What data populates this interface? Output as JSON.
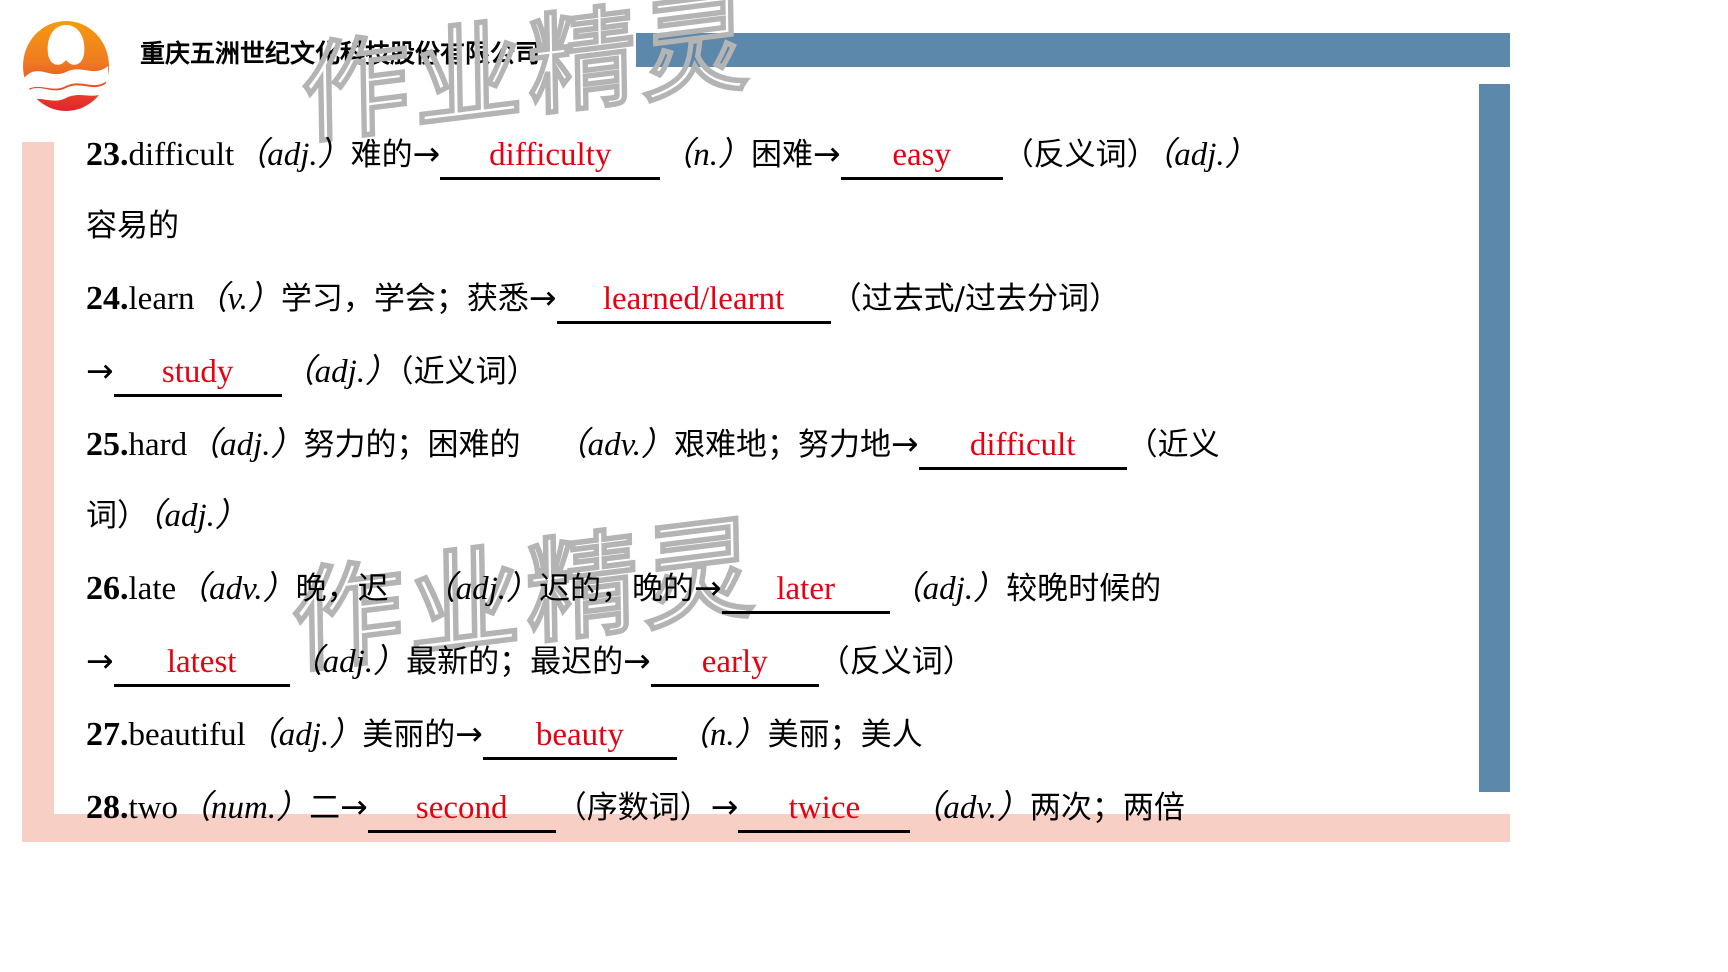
{
  "header": {
    "company_name": "重庆五洲世纪文化科技股份有限公司",
    "logo_name": "wuzhou-logo"
  },
  "watermark": {
    "text": "作业精灵"
  },
  "colors": {
    "answer_red": "#e60012",
    "bar_blue": "#5b88ab",
    "bar_pink": "#f7cfc5",
    "logo_orange": "#f18a1c",
    "logo_red": "#e03a3e"
  },
  "entries": [
    {
      "number": "23.",
      "word": "difficult",
      "parts": [
        {
          "type": "pos",
          "text": "（adj.）"
        },
        {
          "type": "cn",
          "text": "难的"
        },
        {
          "type": "arrow",
          "text": "→"
        },
        {
          "type": "answer",
          "text": "difficulty"
        },
        {
          "type": "pos",
          "text": "（n.）"
        },
        {
          "type": "cn",
          "text": "困难"
        },
        {
          "type": "arrow",
          "text": "→"
        },
        {
          "type": "answer",
          "text": "easy"
        },
        {
          "type": "cn",
          "text": "（反义词）"
        },
        {
          "type": "pos",
          "text": "（adj.）"
        },
        {
          "type": "cn-wrap",
          "text": "容易的"
        }
      ]
    },
    {
      "number": "24.",
      "word": "learn",
      "parts": [
        {
          "type": "pos",
          "text": "（v.）"
        },
        {
          "type": "cn",
          "text": "学习，学会；获悉"
        },
        {
          "type": "arrow",
          "text": "→"
        },
        {
          "type": "answer",
          "text": "learned/learnt"
        },
        {
          "type": "cn",
          "text": "（过去式/过去分词）"
        },
        {
          "type": "arrow-wrap",
          "text": "→"
        },
        {
          "type": "answer",
          "text": "study"
        },
        {
          "type": "pos",
          "text": "（adj.）"
        },
        {
          "type": "cn",
          "text": "（近义词）"
        }
      ]
    },
    {
      "number": "25.",
      "word": "hard",
      "parts": [
        {
          "type": "pos",
          "text": "（adj.）"
        },
        {
          "type": "cn",
          "text": "努力的；困难的"
        },
        {
          "type": "pos",
          "text": "（adv.）"
        },
        {
          "type": "cn",
          "text": "艰难地；努力地"
        },
        {
          "type": "arrow",
          "text": "→"
        },
        {
          "type": "answer",
          "text": "difficult"
        },
        {
          "type": "cn",
          "text": "（近义词）"
        },
        {
          "type": "pos",
          "text": "（adj.）"
        }
      ]
    },
    {
      "number": "26.",
      "word": "late",
      "parts": [
        {
          "type": "pos",
          "text": "（adv.）"
        },
        {
          "type": "cn",
          "text": "晚，迟"
        },
        {
          "type": "pos",
          "text": "（adj.）"
        },
        {
          "type": "cn",
          "text": "迟的，晚的"
        },
        {
          "type": "arrow",
          "text": "→"
        },
        {
          "type": "answer",
          "text": "later"
        },
        {
          "type": "pos",
          "text": "（adj.）"
        },
        {
          "type": "cn",
          "text": "较晚时候的"
        },
        {
          "type": "arrow-wrap",
          "text": "→"
        },
        {
          "type": "answer",
          "text": "latest"
        },
        {
          "type": "pos",
          "text": "（adj.）"
        },
        {
          "type": "cn",
          "text": "最新的；最迟的"
        },
        {
          "type": "arrow",
          "text": "→"
        },
        {
          "type": "answer",
          "text": "early"
        },
        {
          "type": "cn",
          "text": "（反义词）"
        }
      ]
    },
    {
      "number": "27.",
      "word": "beautiful",
      "parts": [
        {
          "type": "pos",
          "text": "（adj.）"
        },
        {
          "type": "cn",
          "text": "美丽的"
        },
        {
          "type": "arrow",
          "text": "→"
        },
        {
          "type": "answer",
          "text": "beauty"
        },
        {
          "type": "pos",
          "text": "（n.）"
        },
        {
          "type": "cn",
          "text": "美丽；美人"
        }
      ]
    },
    {
      "number": "28.",
      "word": "two",
      "parts": [
        {
          "type": "pos",
          "text": "（num.）"
        },
        {
          "type": "cn",
          "text": "二"
        },
        {
          "type": "arrow",
          "text": "→"
        },
        {
          "type": "answer",
          "text": "second"
        },
        {
          "type": "cn",
          "text": "（序数词）"
        },
        {
          "type": "arrow",
          "text": "→"
        },
        {
          "type": "answer",
          "text": "twice"
        },
        {
          "type": "pos",
          "text": "（adv.）"
        },
        {
          "type": "cn",
          "text": "两次；两倍"
        }
      ]
    }
  ],
  "lines": [
    {
      "id": "line-23a",
      "tokens": [
        {
          "k": "num",
          "t": "23."
        },
        {
          "k": "en",
          "t": "difficult"
        },
        {
          "k": "pos",
          "t": "（adj.）"
        },
        {
          "k": "cn",
          "t": "难的"
        },
        {
          "k": "arrow",
          "t": "→"
        },
        {
          "k": "ans",
          "t": "difficulty",
          "w": "184"
        },
        {
          "k": "pos",
          "t": "（n.）"
        },
        {
          "k": "cn",
          "t": "困难"
        },
        {
          "k": "arrow",
          "t": "→"
        },
        {
          "k": "ans",
          "t": "easy",
          "w": "126"
        },
        {
          "k": "cn",
          "t": "（反义词）"
        },
        {
          "k": "pos",
          "t": "（adj.）"
        }
      ]
    },
    {
      "id": "line-23b",
      "tokens": [
        {
          "k": "cn",
          "t": "容易的"
        }
      ]
    },
    {
      "id": "line-24a",
      "tokens": [
        {
          "k": "num",
          "t": "24."
        },
        {
          "k": "en",
          "t": "learn"
        },
        {
          "k": "pos",
          "t": "（v.）"
        },
        {
          "k": "cn",
          "t": "学习，学会；获悉"
        },
        {
          "k": "arrow",
          "t": "→"
        },
        {
          "k": "ans",
          "t": "learned/learnt",
          "w": "238"
        },
        {
          "k": "cn",
          "t": "（过去式/过去分词）"
        }
      ]
    },
    {
      "id": "line-24b",
      "tokens": [
        {
          "k": "arrow",
          "t": "→"
        },
        {
          "k": "ans",
          "t": "study",
          "w": "132"
        },
        {
          "k": "pos",
          "t": "（adj.）"
        },
        {
          "k": "cn",
          "t": "（近义词）"
        }
      ]
    },
    {
      "id": "line-25a",
      "tokens": [
        {
          "k": "num",
          "t": "25."
        },
        {
          "k": "en",
          "t": "hard"
        },
        {
          "k": "pos",
          "t": "（adj.）"
        },
        {
          "k": "cn",
          "t": "努力的；困难的"
        },
        {
          "k": "gap",
          "t": ""
        },
        {
          "k": "pos",
          "t": "（adv.）"
        },
        {
          "k": "cn",
          "t": "艰难地；"
        },
        {
          "k": "cn",
          "t": "努力地"
        },
        {
          "k": "arrow",
          "t": "→"
        },
        {
          "k": "ans",
          "t": "difficult",
          "w": "172"
        },
        {
          "k": "cn",
          "t": "（近义"
        }
      ]
    },
    {
      "id": "line-25b",
      "tokens": [
        {
          "k": "cn",
          "t": "词）"
        },
        {
          "k": "pos",
          "t": "（adj.）"
        }
      ]
    },
    {
      "id": "line-26a",
      "tokens": [
        {
          "k": "num",
          "t": "26."
        },
        {
          "k": "en",
          "t": "late"
        },
        {
          "k": "pos",
          "t": "（adv.）"
        },
        {
          "k": "cn",
          "t": "晚，迟"
        },
        {
          "k": "gap",
          "t": ""
        },
        {
          "k": "pos",
          "t": "（adj.）"
        },
        {
          "k": "cn",
          "t": "迟的，"
        },
        {
          "k": "cn",
          "t": "晚的"
        },
        {
          "k": "arrow",
          "t": "→"
        },
        {
          "k": "ans",
          "t": "later",
          "w": "132"
        },
        {
          "k": "pos",
          "t": "（adj.）"
        },
        {
          "k": "cn",
          "t": "较晚时候的"
        }
      ]
    },
    {
      "id": "line-26b",
      "tokens": [
        {
          "k": "arrow",
          "t": "→"
        },
        {
          "k": "ans",
          "t": "latest",
          "w": "140"
        },
        {
          "k": "pos",
          "t": "（adj.）"
        },
        {
          "k": "cn",
          "t": "最新的；最迟的"
        },
        {
          "k": "arrow",
          "t": "→"
        },
        {
          "k": "ans",
          "t": "early",
          "w": "132"
        },
        {
          "k": "cn",
          "t": "（反义词）"
        }
      ]
    },
    {
      "id": "line-27a",
      "tokens": [
        {
          "k": "num",
          "t": "27."
        },
        {
          "k": "en",
          "t": "beautiful"
        },
        {
          "k": "pos",
          "t": "（adj.）"
        },
        {
          "k": "cn",
          "t": "美丽的"
        },
        {
          "k": "arrow",
          "t": "→"
        },
        {
          "k": "ans",
          "t": "beauty",
          "w": "158"
        },
        {
          "k": "pos",
          "t": "（n.）"
        },
        {
          "k": "cn",
          "t": "美丽；美人"
        }
      ]
    },
    {
      "id": "line-28a",
      "tokens": [
        {
          "k": "num",
          "t": "28."
        },
        {
          "k": "en",
          "t": "two"
        },
        {
          "k": "pos",
          "t": "（num.）"
        },
        {
          "k": "cn",
          "t": "二"
        },
        {
          "k": "arrow",
          "t": "→"
        },
        {
          "k": "ans",
          "t": "second",
          "w": "152"
        },
        {
          "k": "cn",
          "t": "（序数词）"
        },
        {
          "k": "arrow",
          "t": "→"
        },
        {
          "k": "ans",
          "t": "twice",
          "w": "136"
        },
        {
          "k": "pos",
          "t": "（adv.）"
        },
        {
          "k": "cn",
          "t": "两次；两倍"
        }
      ]
    }
  ]
}
